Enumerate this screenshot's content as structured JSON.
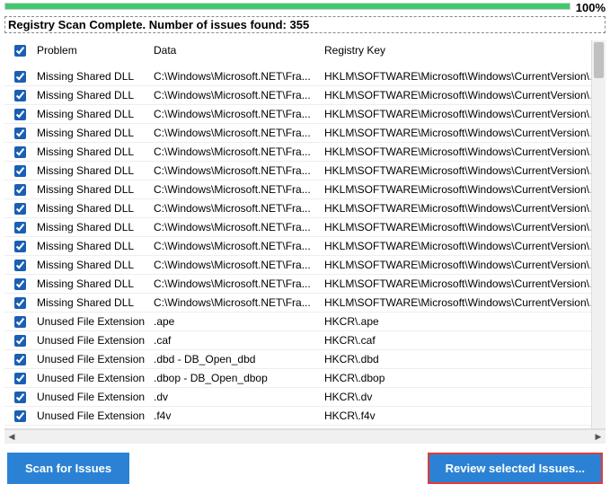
{
  "progress": {
    "percent_label": "100%"
  },
  "header": {
    "text": "Registry Scan Complete. Number of issues found: 355"
  },
  "columns": {
    "problem": "Problem",
    "data": "Data",
    "key": "Registry Key"
  },
  "rows": [
    {
      "problem": "Missing Shared DLL",
      "data": "C:\\Windows\\Microsoft.NET\\Fra...",
      "key": "HKLM\\SOFTWARE\\Microsoft\\Windows\\CurrentVersion\\SharedDlls"
    },
    {
      "problem": "Missing Shared DLL",
      "data": "C:\\Windows\\Microsoft.NET\\Fra...",
      "key": "HKLM\\SOFTWARE\\Microsoft\\Windows\\CurrentVersion\\SharedDlls"
    },
    {
      "problem": "Missing Shared DLL",
      "data": "C:\\Windows\\Microsoft.NET\\Fra...",
      "key": "HKLM\\SOFTWARE\\Microsoft\\Windows\\CurrentVersion\\SharedDlls"
    },
    {
      "problem": "Missing Shared DLL",
      "data": "C:\\Windows\\Microsoft.NET\\Fra...",
      "key": "HKLM\\SOFTWARE\\Microsoft\\Windows\\CurrentVersion\\SharedDlls"
    },
    {
      "problem": "Missing Shared DLL",
      "data": "C:\\Windows\\Microsoft.NET\\Fra...",
      "key": "HKLM\\SOFTWARE\\Microsoft\\Windows\\CurrentVersion\\SharedDlls"
    },
    {
      "problem": "Missing Shared DLL",
      "data": "C:\\Windows\\Microsoft.NET\\Fra...",
      "key": "HKLM\\SOFTWARE\\Microsoft\\Windows\\CurrentVersion\\SharedDlls"
    },
    {
      "problem": "Missing Shared DLL",
      "data": "C:\\Windows\\Microsoft.NET\\Fra...",
      "key": "HKLM\\SOFTWARE\\Microsoft\\Windows\\CurrentVersion\\SharedDlls"
    },
    {
      "problem": "Missing Shared DLL",
      "data": "C:\\Windows\\Microsoft.NET\\Fra...",
      "key": "HKLM\\SOFTWARE\\Microsoft\\Windows\\CurrentVersion\\SharedDlls"
    },
    {
      "problem": "Missing Shared DLL",
      "data": "C:\\Windows\\Microsoft.NET\\Fra...",
      "key": "HKLM\\SOFTWARE\\Microsoft\\Windows\\CurrentVersion\\SharedDlls"
    },
    {
      "problem": "Missing Shared DLL",
      "data": "C:\\Windows\\Microsoft.NET\\Fra...",
      "key": "HKLM\\SOFTWARE\\Microsoft\\Windows\\CurrentVersion\\SharedDlls"
    },
    {
      "problem": "Missing Shared DLL",
      "data": "C:\\Windows\\Microsoft.NET\\Fra...",
      "key": "HKLM\\SOFTWARE\\Microsoft\\Windows\\CurrentVersion\\SharedDlls"
    },
    {
      "problem": "Missing Shared DLL",
      "data": "C:\\Windows\\Microsoft.NET\\Fra...",
      "key": "HKLM\\SOFTWARE\\Microsoft\\Windows\\CurrentVersion\\SharedDlls"
    },
    {
      "problem": "Missing Shared DLL",
      "data": "C:\\Windows\\Microsoft.NET\\Fra...",
      "key": "HKLM\\SOFTWARE\\Microsoft\\Windows\\CurrentVersion\\SharedDlls"
    },
    {
      "problem": "Unused File Extension",
      "data": ".ape",
      "key": "HKCR\\.ape"
    },
    {
      "problem": "Unused File Extension",
      "data": ".caf",
      "key": "HKCR\\.caf"
    },
    {
      "problem": "Unused File Extension",
      "data": ".dbd - DB_Open_dbd",
      "key": "HKCR\\.dbd"
    },
    {
      "problem": "Unused File Extension",
      "data": ".dbop - DB_Open_dbop",
      "key": "HKCR\\.dbop"
    },
    {
      "problem": "Unused File Extension",
      "data": ".dv",
      "key": "HKCR\\.dv"
    },
    {
      "problem": "Unused File Extension",
      "data": ".f4v",
      "key": "HKCR\\.f4v"
    }
  ],
  "buttons": {
    "scan": "Scan for Issues",
    "review": "Review selected Issues..."
  }
}
